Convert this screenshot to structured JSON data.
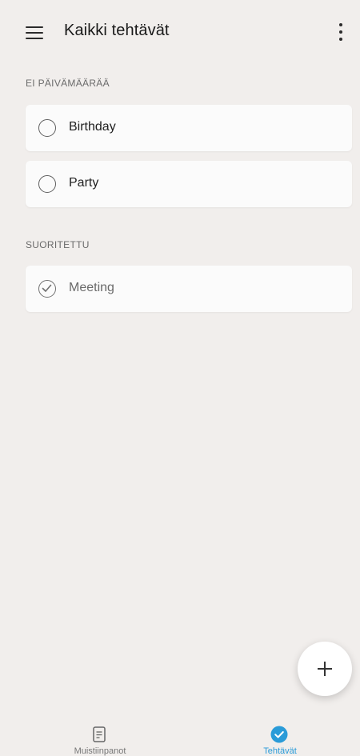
{
  "header": {
    "title": "Kaikki tehtävät"
  },
  "sections": [
    {
      "title": "EI PÄIVÄMÄÄRÄÄ",
      "tasks": [
        {
          "label": "Birthday",
          "done": false
        },
        {
          "label": "Party",
          "done": false
        }
      ]
    },
    {
      "title": "SUORITETTU",
      "tasks": [
        {
          "label": "Meeting",
          "done": true
        }
      ]
    }
  ],
  "bottom_nav": {
    "items": [
      {
        "label": "Muistiinpanot",
        "icon": "note-icon",
        "active": false
      },
      {
        "label": "Tehtävät",
        "icon": "check-circle-icon",
        "active": true
      }
    ]
  },
  "colors": {
    "background": "#f1eeec",
    "accent": "#2a9bd8",
    "card": "#fbfbfb"
  }
}
